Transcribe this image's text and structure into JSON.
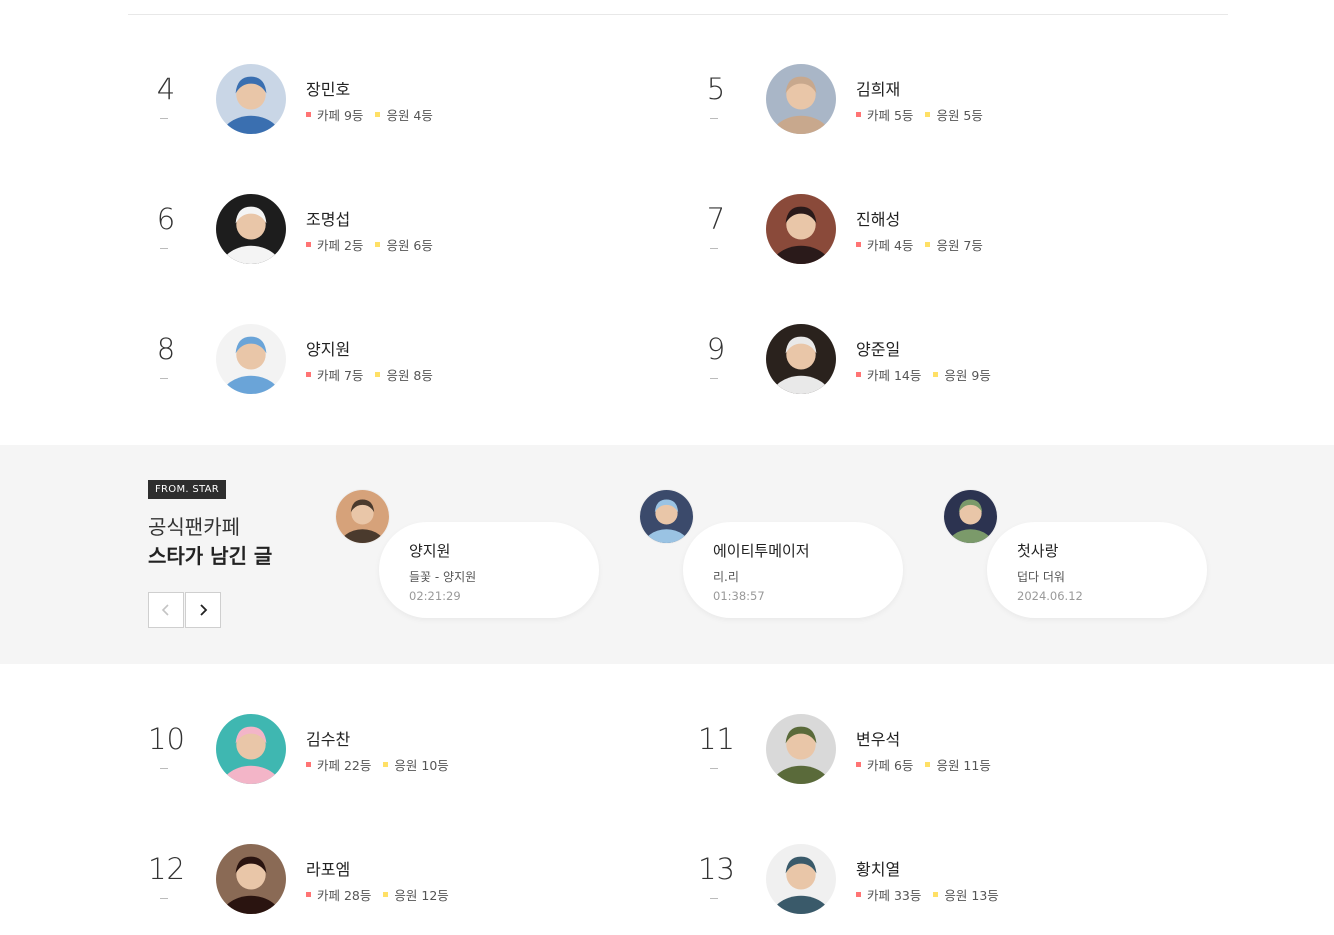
{
  "ranking_top": [
    {
      "rank": "4",
      "name": "장민호",
      "cafe": "카페 9등",
      "support": "응원 4등",
      "colors": [
        "#3a6fb0",
        "#c9d6e6"
      ]
    },
    {
      "rank": "5",
      "name": "김희재",
      "cafe": "카페 5등",
      "support": "응원 5등",
      "colors": [
        "#c8a88d",
        "#a9b6c7"
      ]
    },
    {
      "rank": "6",
      "name": "조명섭",
      "cafe": "카페 2등",
      "support": "응원 6등",
      "colors": [
        "#f4f4f4",
        "#1d1d1d"
      ]
    },
    {
      "rank": "7",
      "name": "진해성",
      "cafe": "카페 4등",
      "support": "응원 7등",
      "colors": [
        "#2a1a1a",
        "#8a4a3a"
      ]
    },
    {
      "rank": "8",
      "name": "양지원",
      "cafe": "카페 7등",
      "support": "응원 8등",
      "colors": [
        "#6aa4d8",
        "#f3f3f3"
      ]
    },
    {
      "rank": "9",
      "name": "양준일",
      "cafe": "카페 14등",
      "support": "응원 9등",
      "colors": [
        "#e9e9e9",
        "#2a221d"
      ]
    }
  ],
  "from_star": {
    "badge": "FROM. STAR",
    "title_line1": "공식팬카페",
    "title_line2": "스타가 남긴 글",
    "prev_icon": "chevron-left-icon",
    "next_icon": "chevron-right-icon",
    "cards": [
      {
        "name": "양지원",
        "text": "들꽃 - 양지원",
        "time": "02:21:29",
        "colors": [
          "#4a3a2d",
          "#d6a27a"
        ]
      },
      {
        "name": "에이티투메이저",
        "text": "리.리",
        "time": "01:38:57",
        "colors": [
          "#9ac3e3",
          "#3b4a6b"
        ]
      },
      {
        "name": "첫사랑",
        "text": "덥다 더워",
        "time": "2024.06.12",
        "colors": [
          "#7b9a6a",
          "#2c3350"
        ]
      }
    ]
  },
  "ranking_bottom": [
    {
      "rank": "10",
      "name": "김수찬",
      "cafe": "카페 22등",
      "support": "응원 10등",
      "colors": [
        "#f3b5c8",
        "#3fb7b1"
      ]
    },
    {
      "rank": "11",
      "name": "변우석",
      "cafe": "카페 6등",
      "support": "응원 11등",
      "colors": [
        "#5a6a3a",
        "#d9d9d9"
      ]
    },
    {
      "rank": "12",
      "name": "라포엠",
      "cafe": "카페 28등",
      "support": "응원 12등",
      "colors": [
        "#2a1410",
        "#8a6a55"
      ]
    },
    {
      "rank": "13",
      "name": "황치열",
      "cafe": "카페 33등",
      "support": "응원 13등",
      "colors": [
        "#3a5a6a",
        "#f0f0f0"
      ]
    }
  ]
}
